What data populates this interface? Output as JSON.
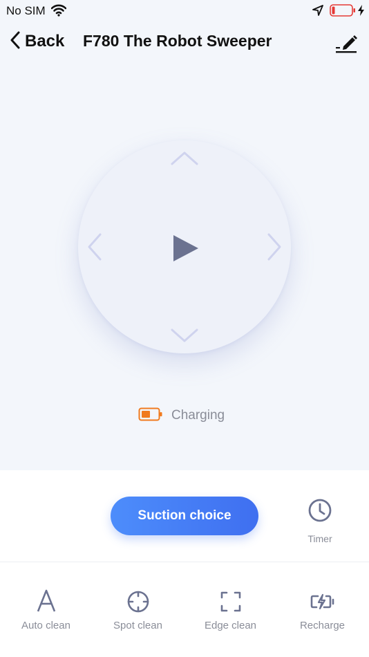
{
  "status_bar": {
    "carrier": "No SIM",
    "icons": [
      "wifi-icon",
      "location-arrow-icon",
      "battery-low-icon",
      "charging-bolt-icon"
    ]
  },
  "nav": {
    "back_label": "Back",
    "title": "F780 The Robot Sweeper",
    "edit_icon": "pencil-icon"
  },
  "joystick": {
    "icons": [
      "chevron-up-icon",
      "chevron-down-icon",
      "chevron-left-icon",
      "chevron-right-icon",
      "play-icon"
    ]
  },
  "status": {
    "charging_label": "Charging",
    "battery_icon": "battery-low-icon"
  },
  "actions": {
    "suction_label": "Suction choice",
    "timer_label": "Timer"
  },
  "bottom_nav": [
    {
      "label": "Auto clean",
      "icon": "auto-clean-icon"
    },
    {
      "label": "Spot clean",
      "icon": "spot-clean-icon"
    },
    {
      "label": "Edge clean",
      "icon": "edge-clean-icon"
    },
    {
      "label": "Recharge",
      "icon": "recharge-icon"
    }
  ],
  "colors": {
    "accent": "#4480f5",
    "background": "#f3f6fb",
    "joystick_arrows": "#cfd3ee",
    "play": "#6b7290",
    "battery_orange": "#f07a1e",
    "battery_red": "#e53935",
    "muted_text": "#8a8d98"
  }
}
